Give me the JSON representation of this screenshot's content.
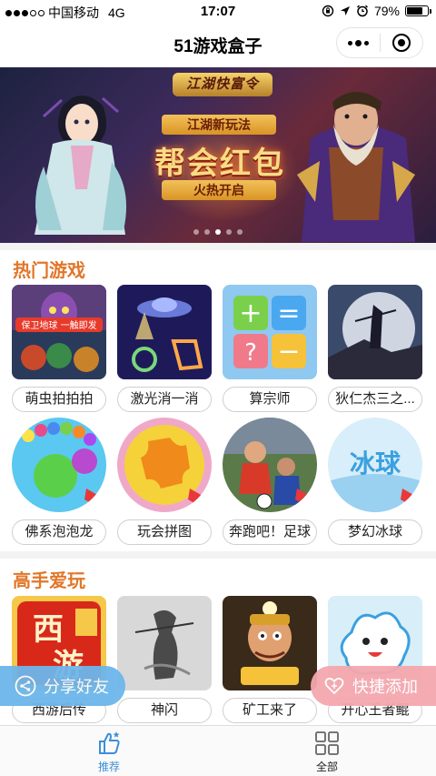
{
  "status_bar": {
    "carrier": "中国移动",
    "network": "4G",
    "time": "17:07",
    "battery_percent": "79%",
    "battery_level": 0.79
  },
  "nav": {
    "title": "51游戏盒子"
  },
  "banner": {
    "brand": "江湖快富令",
    "subtitle": "江湖新玩法",
    "headline": "帮会红包",
    "button": "火热开启",
    "page_count": 5,
    "active_index": 2
  },
  "sections": {
    "hot": {
      "title": "热门游戏",
      "games": [
        {
          "name": "萌虫拍拍拍"
        },
        {
          "name": "激光消一消"
        },
        {
          "name": "算宗师"
        },
        {
          "name": "狄仁杰三之..."
        },
        {
          "name": "佛系泡泡龙"
        },
        {
          "name": "玩会拼图"
        },
        {
          "name": "奔跑吧！足球"
        },
        {
          "name": "梦幻冰球"
        }
      ]
    },
    "pro": {
      "title": "高手爱玩",
      "games": [
        {
          "name": "西游后传"
        },
        {
          "name": "神闪"
        },
        {
          "name": "矿工来了"
        },
        {
          "name": "开心王者鲲"
        }
      ]
    }
  },
  "floating": {
    "share_label": "分享好友",
    "add_label": "快捷添加"
  },
  "tab_bar": {
    "tabs": [
      {
        "label": "推荐",
        "icon": "thumbs-up-icon"
      },
      {
        "label": "全部",
        "icon": "grid-icon"
      }
    ]
  },
  "colors": {
    "accent_orange": "#e2762a",
    "tab_active": "#3d8fd6",
    "share_blue": "#6db6ea",
    "add_pink": "#f5a7ae"
  }
}
